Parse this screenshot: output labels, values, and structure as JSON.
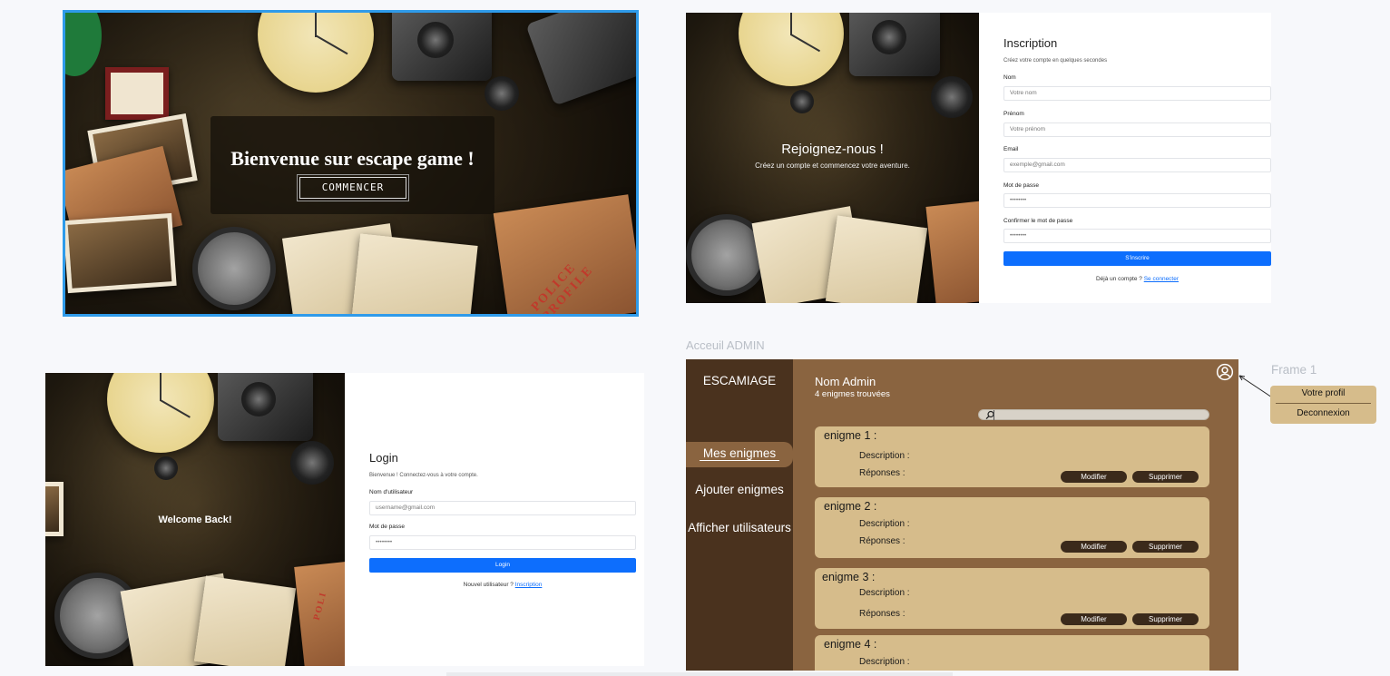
{
  "welcome_panel": {
    "title": "Bienvenue sur escape game !",
    "start_button": "COMMENCER",
    "stamp": "POLICE PROFILE"
  },
  "signup_panel": {
    "image_title": "Rejoignez-nous !",
    "image_subtitle": "Créez un compte et commencez votre aventure.",
    "form": {
      "title": "Inscription",
      "subtitle": "Créez votre compte en quelques secondes",
      "fields": [
        {
          "label": "Nom",
          "placeholder": "Votre nom"
        },
        {
          "label": "Prénom",
          "placeholder": "Votre prénom"
        },
        {
          "label": "Email",
          "placeholder": "exemple@gmail.com"
        },
        {
          "label": "Mot de passe",
          "placeholder": "••••••••"
        },
        {
          "label": "Confirmer le mot de passe",
          "placeholder": "••••••••"
        }
      ],
      "submit": "S'inscrire",
      "footer_text": "Déjà un compte ? ",
      "footer_link": "Se connecter"
    }
  },
  "login_panel": {
    "image_title": "Welcome Back!",
    "stamp": "POLI",
    "form": {
      "title": "Login",
      "subtitle": "Bienvenue ! Connectez-vous à votre compte.",
      "fields": [
        {
          "label": "Nom d'utilisateur",
          "placeholder": "username@gmail.com"
        },
        {
          "label": "Mot de passe",
          "placeholder": "••••••••"
        }
      ],
      "submit": "Login",
      "footer_text": "Nouvel utilisateur ? ",
      "footer_link": "Inscription"
    }
  },
  "admin_panel": {
    "frame_title": "Acceuil ADMIN",
    "brand": "ESCAMIAGE",
    "nav": [
      "Mes enigmes",
      "Ajouter enigmes",
      "Afficher utilisateurs"
    ],
    "user_name": "Nom Admin",
    "enigme_count": "4 enigmes trouvées",
    "search_placeholder": "",
    "cards": [
      {
        "title": "enigme 1 :",
        "description": "Description :",
        "answers": "Réponses :",
        "edit": "Modifier",
        "delete": "Supprimer"
      },
      {
        "title": "enigme 2 :",
        "description": "Description :",
        "answers": "Réponses :",
        "edit": "Modifier",
        "delete": "Supprimer"
      },
      {
        "title": "enigme 3 :",
        "description": "Description :",
        "answers": "Réponses :",
        "edit": "Modifier",
        "delete": "Supprimer"
      },
      {
        "title": "enigme 4 :",
        "description": "Description :",
        "answers": "",
        "edit": "",
        "delete": ""
      }
    ],
    "icons": {
      "profile": "user-circle-icon",
      "search": "search-icon"
    }
  },
  "profile_menu": {
    "frame_title": "Frame 1",
    "items": [
      "Votre profil",
      "Deconnexion"
    ]
  },
  "colors": {
    "accent_blue": "#0d6efd",
    "selection_outline": "#2f9bea",
    "admin_bg": "#8a6440",
    "sidebar_bg": "#4a321e",
    "card_bg": "#d6bc8b",
    "card_button": "#3b2a1b"
  }
}
